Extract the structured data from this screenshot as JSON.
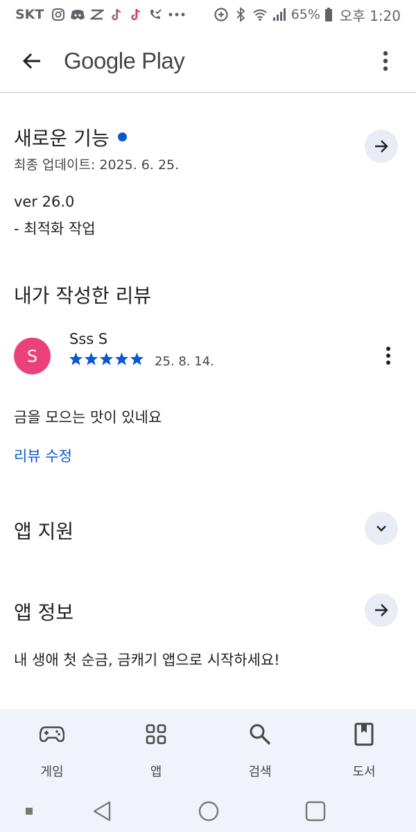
{
  "status_bar": {
    "carrier": "SKT",
    "battery_percent": "65%",
    "time": "오후 1:20"
  },
  "app_bar": {
    "title": "Google Play"
  },
  "whats_new": {
    "title": "새로운 기능",
    "last_updated": "최종 업데이트: 2025. 6. 25.",
    "version": "ver 26.0",
    "notes": "- 최적화 작업"
  },
  "my_review": {
    "title": "내가 작성한 리뷰",
    "avatar_letter": "S",
    "reviewer_name": "Sss S",
    "rating": 5,
    "date": "25. 8. 14.",
    "text": "금을 모으는 맛이 있네요",
    "edit_link": "리뷰 수정"
  },
  "app_support": {
    "title": "앱 지원"
  },
  "app_info": {
    "title": "앱 정보",
    "description": "내 생애 첫 순금, 금캐기 앱으로 시작하세요!"
  },
  "bottom_nav": {
    "items": [
      {
        "label": "게임",
        "icon": "gamepad-icon"
      },
      {
        "label": "앱",
        "icon": "apps-grid-icon"
      },
      {
        "label": "검색",
        "icon": "search-icon"
      },
      {
        "label": "도서",
        "icon": "book-icon"
      }
    ]
  },
  "colors": {
    "accent": "#0b57d0",
    "avatar": "#ec407a",
    "button_bg": "#e8ecf4",
    "nav_bg": "#f0f3f9"
  }
}
